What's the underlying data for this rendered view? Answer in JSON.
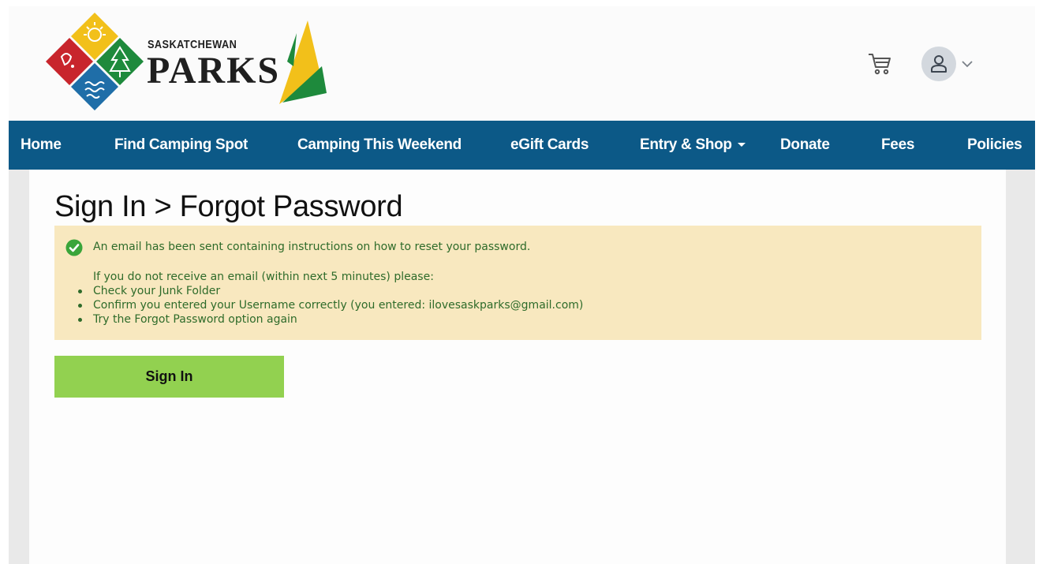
{
  "header": {
    "brand_line1": "SASKATCHEWAN",
    "brand_line2": "PARKS",
    "cart_icon": "shopping-cart-icon",
    "account_icon": "user-icon",
    "account_chevron_icon": "chevron-down-icon"
  },
  "nav": {
    "items": [
      {
        "label": "Home"
      },
      {
        "label": "Find Camping Spot"
      },
      {
        "label": "Camping This Weekend"
      },
      {
        "label": "eGift Cards"
      },
      {
        "label": "Entry & Shop",
        "has_dropdown": true
      },
      {
        "label": "Donate"
      },
      {
        "label": "Fees"
      },
      {
        "label": "Policies"
      }
    ]
  },
  "page": {
    "title": "Sign In > Forgot Password"
  },
  "alert": {
    "icon": "check-circle-icon",
    "message": "An email has been sent containing instructions on how to reset your password.",
    "hint": "If you do not receive an email (within next 5 minutes) please:",
    "items": [
      "Check your Junk Folder",
      "Confirm you entered your Username correctly (you entered: ilovesaskparks@gmail.com)",
      "Try the Forgot Password option again"
    ]
  },
  "actions": {
    "signin_label": "Sign In"
  },
  "colors": {
    "nav_bg": "#0c5987",
    "alert_bg": "#f8e8bf",
    "alert_text": "#2e6b2a",
    "signin_bg": "#92d150",
    "logo_red": "#c8252c",
    "logo_yellow": "#f2c01a",
    "logo_green": "#1e8a3c",
    "logo_blue": "#1f6ea8"
  }
}
